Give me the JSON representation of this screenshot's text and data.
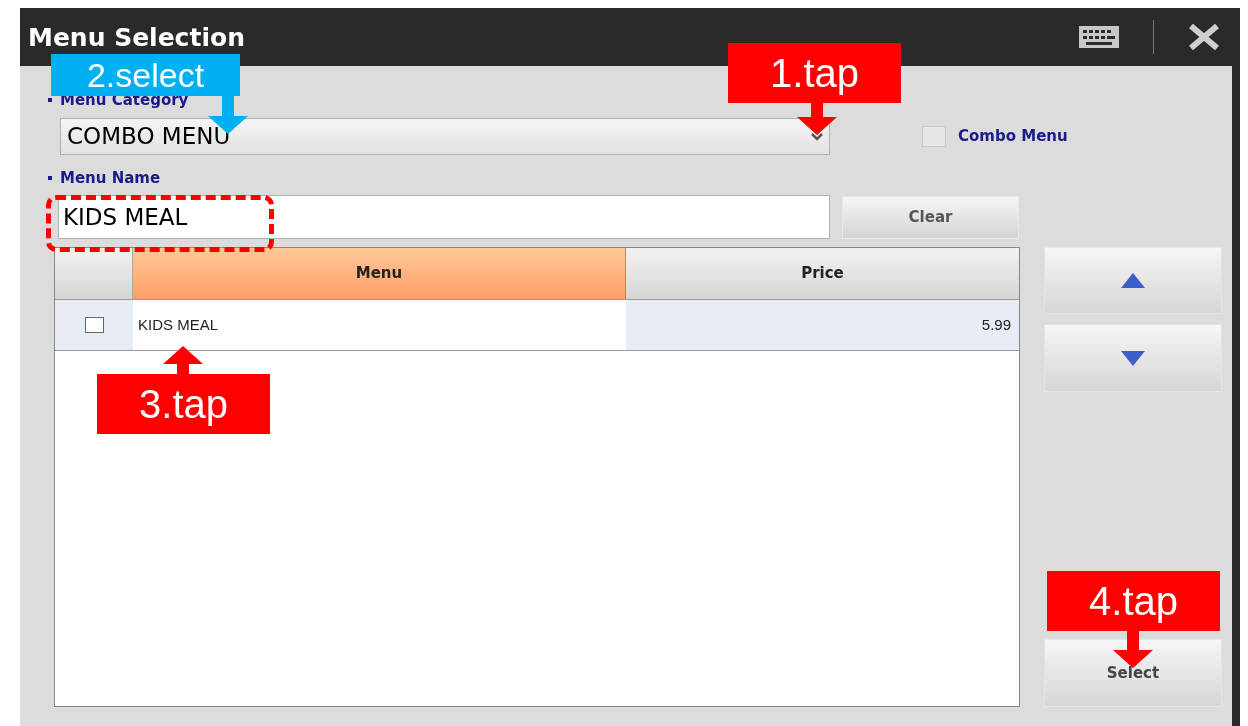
{
  "window": {
    "title": "Menu Selection"
  },
  "form": {
    "category_label": "Menu Category",
    "category_value": "COMBO MENU",
    "combo_checkbox": {
      "label": "Combo Menu",
      "checked": false
    },
    "name_label": "Menu Name",
    "name_value": "KIDS MEAL",
    "clear_button": "Clear"
  },
  "table": {
    "columns": [
      "Menu",
      "Price"
    ],
    "rows": [
      {
        "checked": false,
        "menu": "KIDS MEAL",
        "price": "5.99"
      }
    ]
  },
  "select_button": "Select",
  "annotations": [
    {
      "kind": "callout_down",
      "label": "1.tap",
      "color": "#ff0000"
    },
    {
      "kind": "callout_down",
      "label": "2.select",
      "color": "#00b0f0"
    },
    {
      "kind": "highlight",
      "color": "#ff0000"
    },
    {
      "kind": "callout_up",
      "label": "3.tap",
      "color": "#ff0000"
    },
    {
      "kind": "callout_down",
      "label": "4.tap",
      "color": "#ff0000"
    }
  ]
}
